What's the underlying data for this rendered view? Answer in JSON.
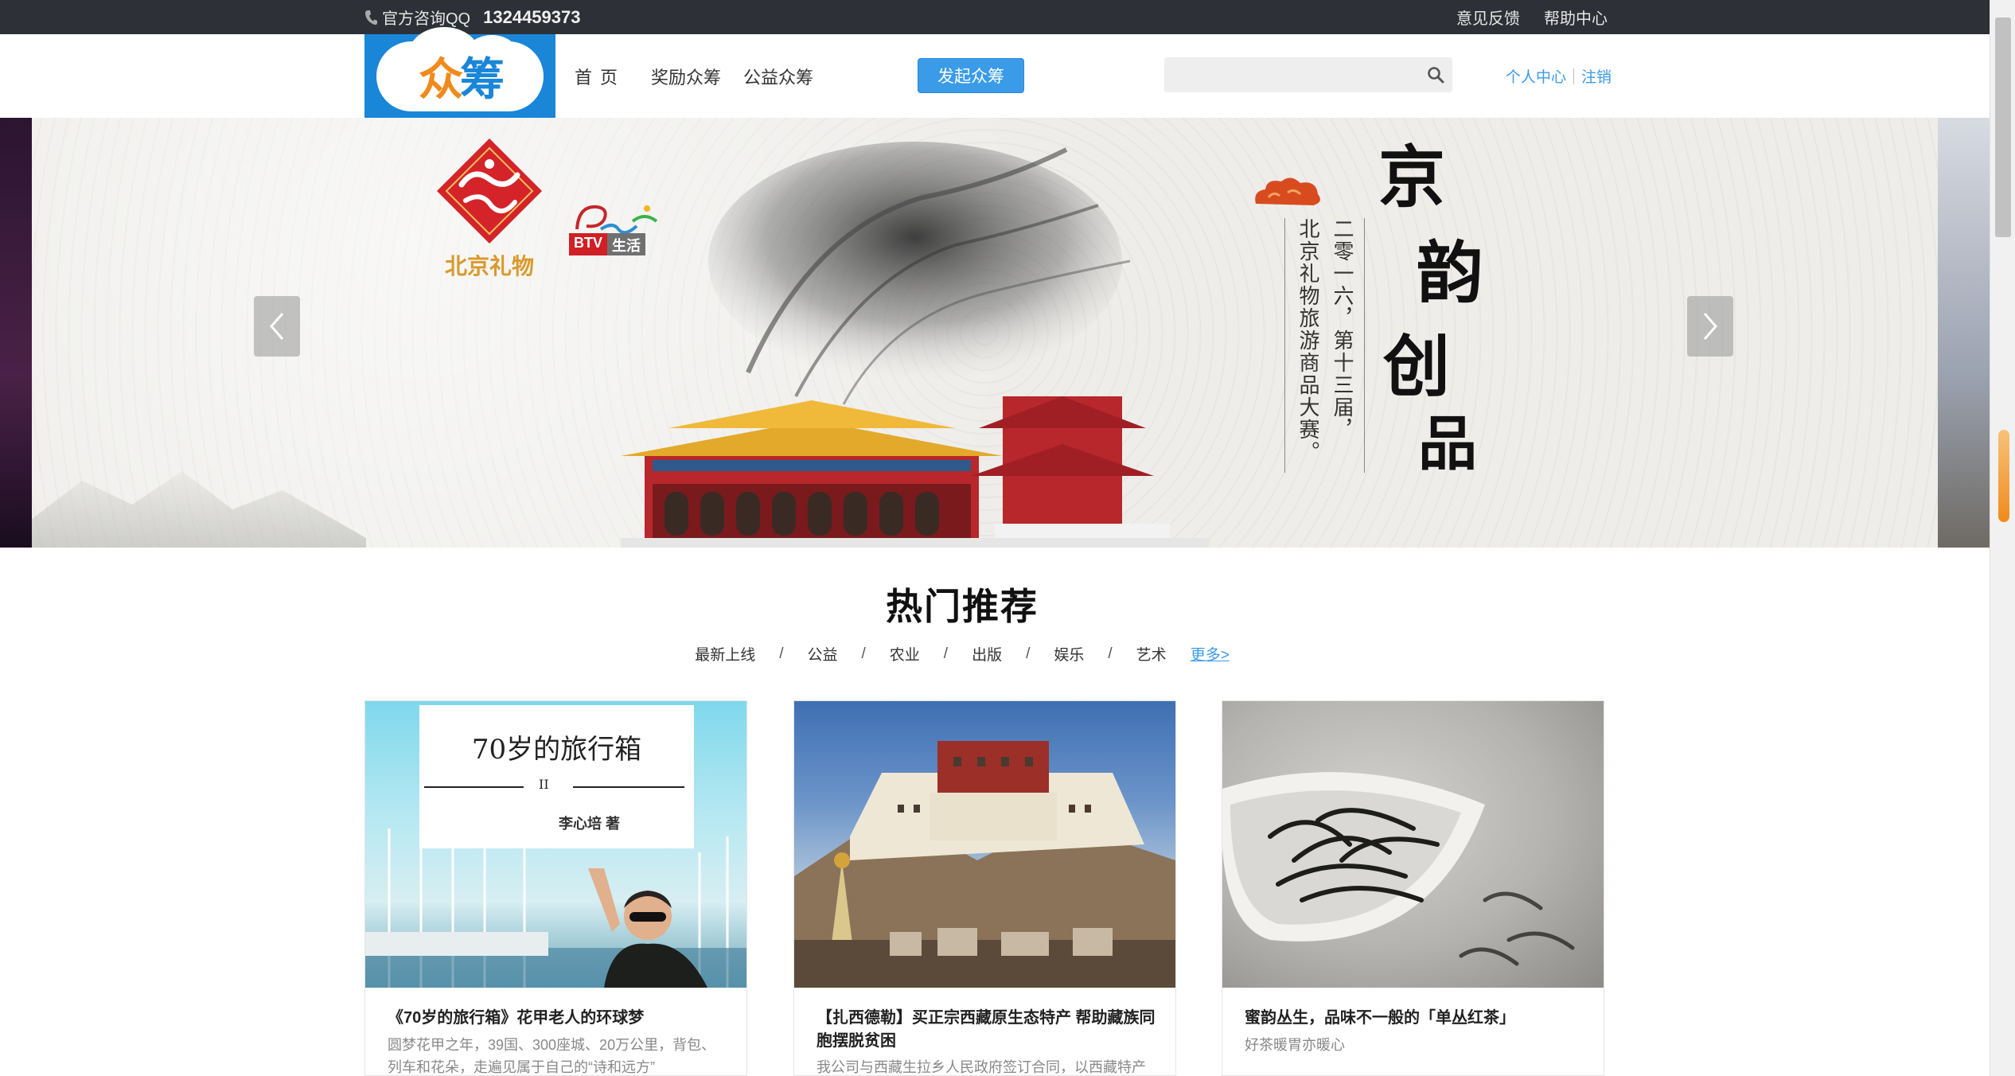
{
  "topbar": {
    "consult_label": "官方咨询QQ",
    "qq_number": "1324459373",
    "feedback": "意见反馈",
    "help": "帮助中心"
  },
  "header": {
    "logo_text_a": "众",
    "logo_text_b": "筹",
    "nav": {
      "home": "首页",
      "reward": "奖励众筹",
      "charity": "公益众筹"
    },
    "launch_button": "发起众筹",
    "search_placeholder": "",
    "user_center": "个人中心",
    "logout": "注销"
  },
  "banner": {
    "bj_caption": "北京礼物",
    "btv_left": "BTV",
    "btv_right": "生活",
    "poem_col1": "二零一六，第十三届，",
    "poem_col2": "北京礼物旅游商品大赛。",
    "title_chars": [
      "京",
      "韵",
      "创",
      "品"
    ]
  },
  "hot": {
    "title": "热门推荐",
    "categories": [
      "最新上线",
      "公益",
      "农业",
      "出版",
      "娱乐",
      "艺术"
    ],
    "more": "更多>"
  },
  "cards": [
    {
      "title": "《70岁的旅行箱》花甲老人的环球梦",
      "desc": "圆梦花甲之年，39国、300座城、20万公里，背包、列车和花朵，走遍见属于自己的“诗和远方”",
      "book_title": "70岁的旅行箱",
      "book_mark": "II",
      "book_author": "李心培 著"
    },
    {
      "title": "【扎西德勒】买正宗西藏原生态特产 帮助藏族同胞摆脱贫困",
      "desc": "我公司与西藏生拉乡人民政府签订合同，以西藏特产"
    },
    {
      "title": "蜜韵丛生，品味不一般的「单丛红茶」",
      "desc": "好茶暖胃亦暖心"
    }
  ],
  "colors": {
    "topbar_bg": "#2d3036",
    "brand_blue": "#3a9be8",
    "logo_bg": "#1a86d8",
    "logo_orange": "#f08a1c"
  }
}
